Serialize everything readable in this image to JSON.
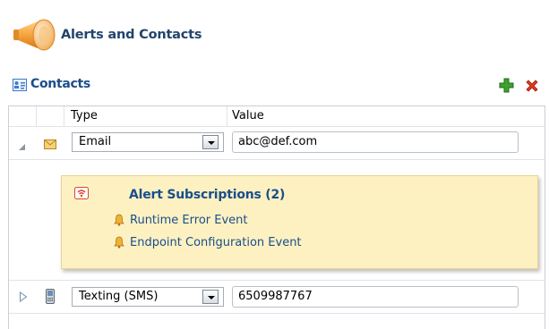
{
  "page": {
    "title": "Alerts and Contacts"
  },
  "contacts": {
    "title": "Contacts",
    "columns": {
      "type": "Type",
      "value": "Value"
    },
    "rows": [
      {
        "type": "Email",
        "value": "abc@def.com",
        "expanded": true
      },
      {
        "type": "Texting (SMS)",
        "value": "6509987767",
        "expanded": false
      }
    ]
  },
  "alerts": {
    "title": "Alert Subscriptions (2)",
    "items": [
      "Runtime Error Event",
      "Endpoint Configuration Event"
    ]
  },
  "colors": {
    "title": "#22446b",
    "link": "#1a4e8b",
    "alert_bg": "#fdf1c2"
  }
}
